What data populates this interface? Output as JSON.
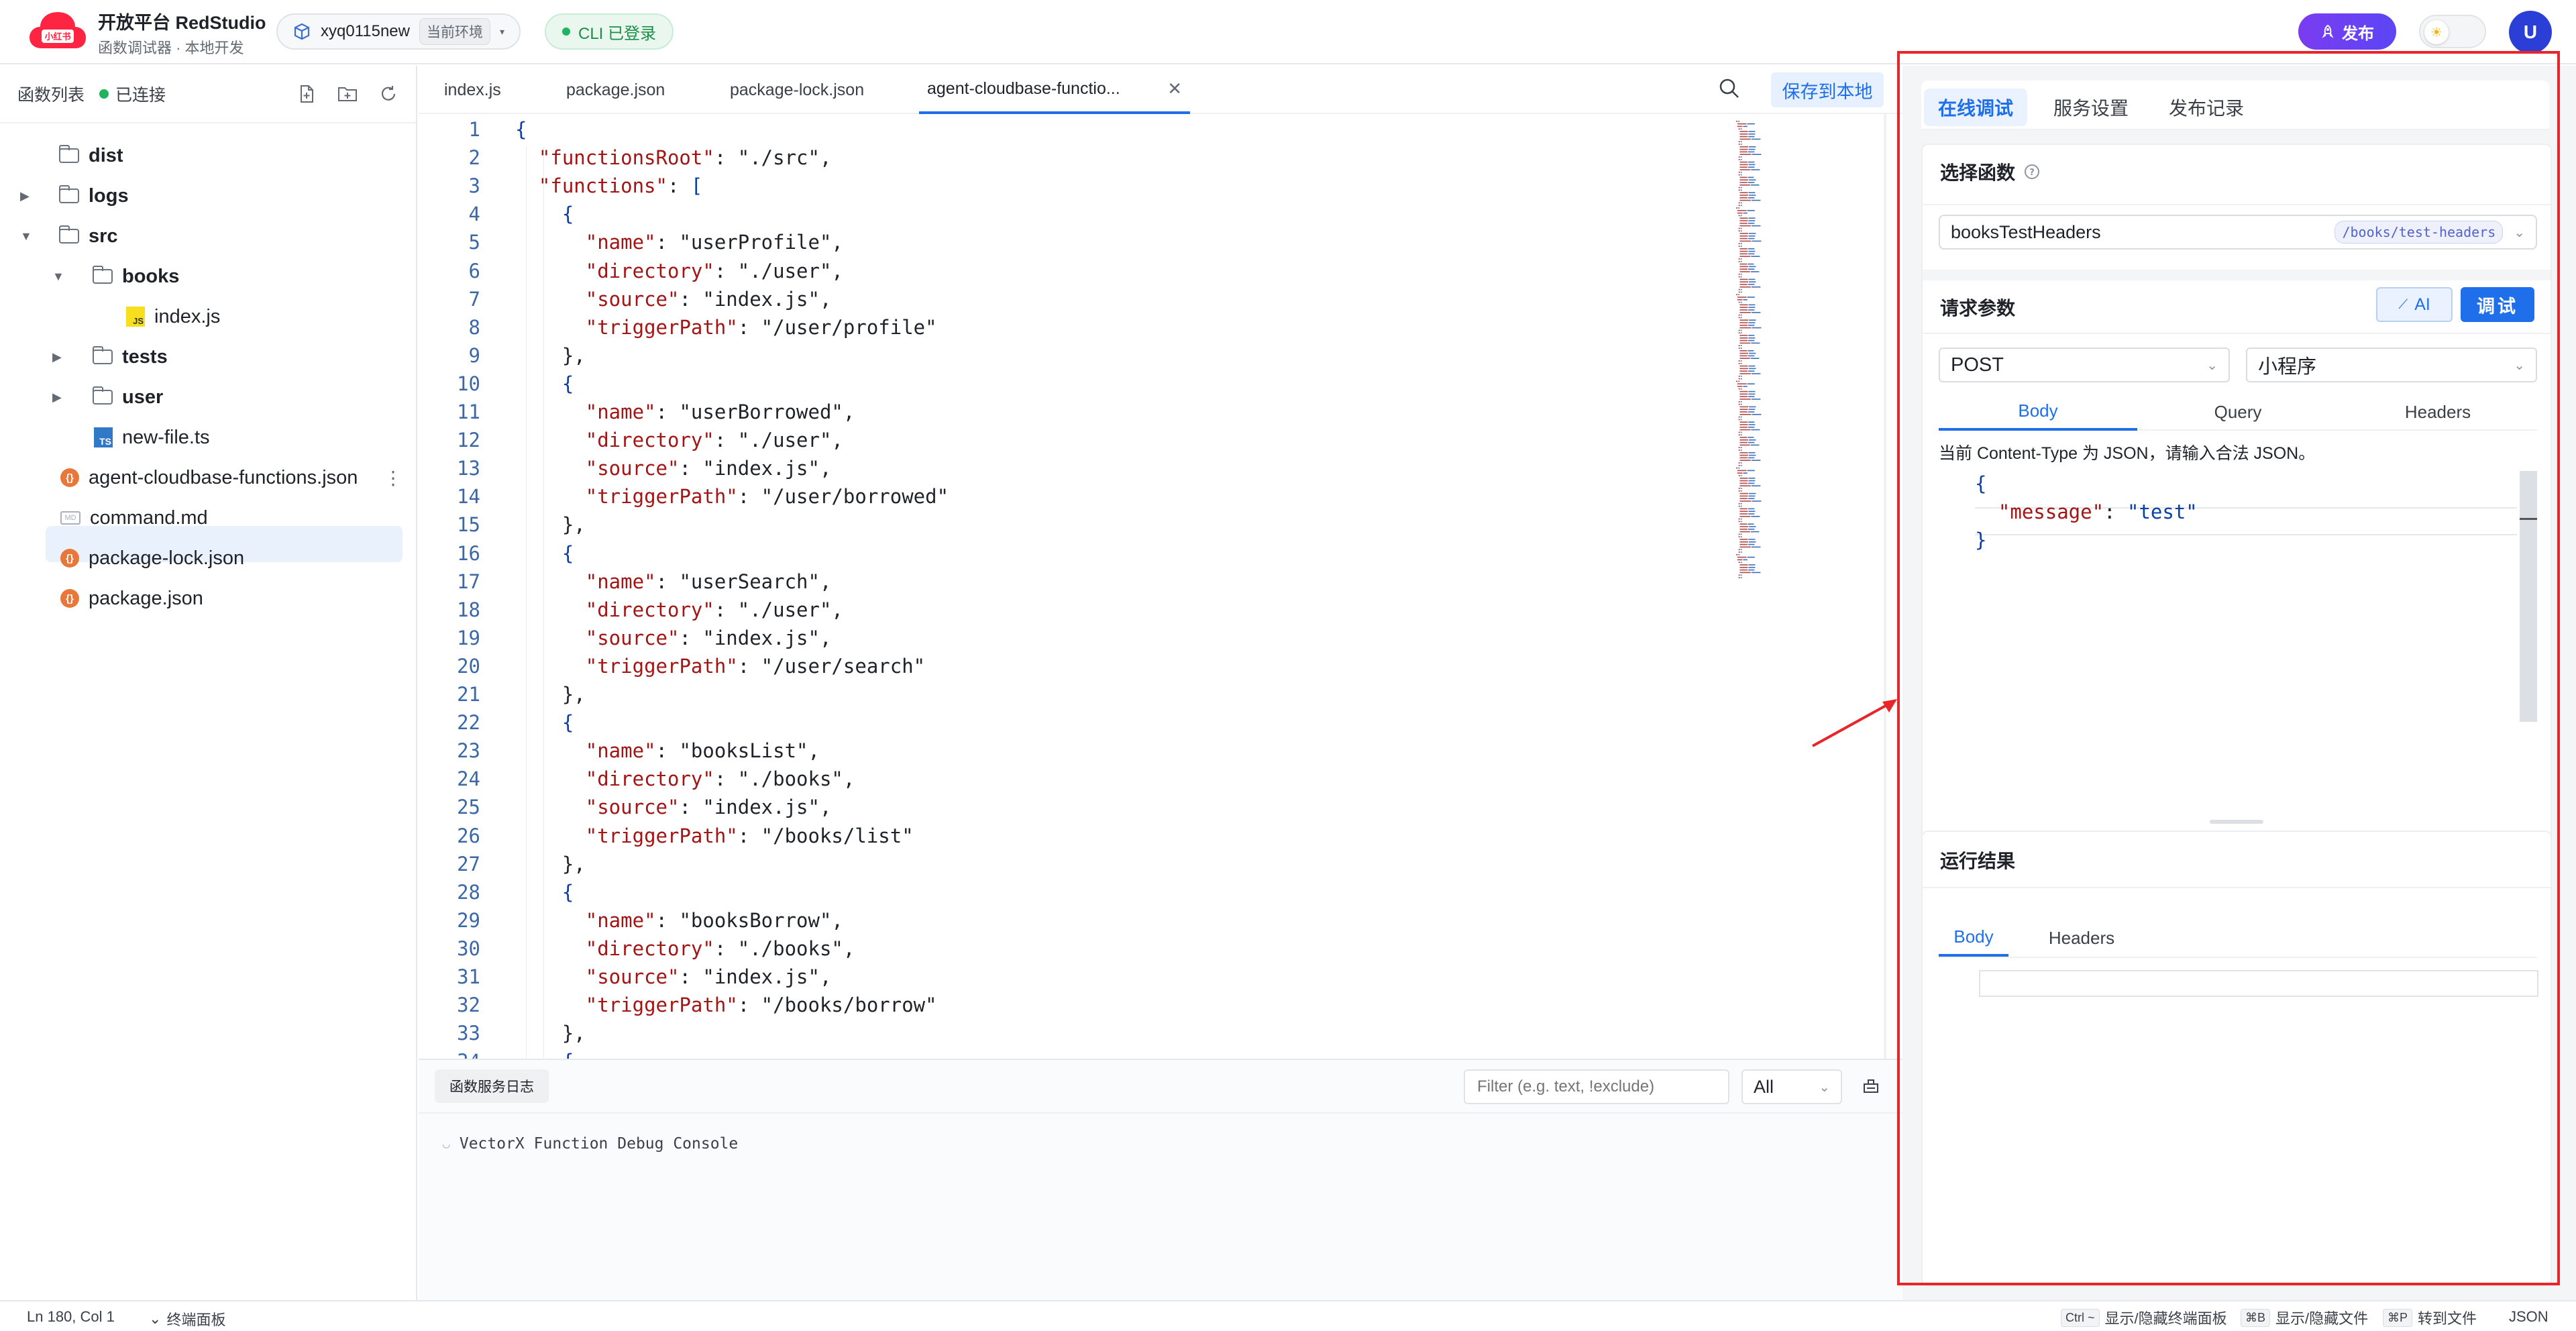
{
  "topbar": {
    "logo_text": "小红书",
    "title": "开放平台 RedStudio",
    "subtitle": "函数调试器 · 本地开发",
    "env_name": "xyq0115new",
    "env_tag": "当前环境",
    "cli_status": "CLI 已登录",
    "publish_label": "发布",
    "avatar_letter": "U"
  },
  "sidebar": {
    "title": "函数列表",
    "status": "已连接",
    "tree": [
      {
        "label": "dist",
        "kind": "folder",
        "expanded": null
      },
      {
        "label": "logs",
        "kind": "folder",
        "expanded": false
      },
      {
        "label": "src",
        "kind": "folder",
        "expanded": true
      },
      {
        "label": "books",
        "kind": "folder",
        "expanded": true
      },
      {
        "label": "index.js",
        "kind": "js"
      },
      {
        "label": "tests",
        "kind": "folder",
        "expanded": false
      },
      {
        "label": "user",
        "kind": "folder",
        "expanded": false
      },
      {
        "label": "new-file.ts",
        "kind": "ts"
      },
      {
        "label": "agent-cloudbase-functions.json",
        "kind": "json",
        "selected": true
      },
      {
        "label": "command.md",
        "kind": "md"
      },
      {
        "label": "package-lock.json",
        "kind": "json"
      },
      {
        "label": "package.json",
        "kind": "json"
      }
    ]
  },
  "editor": {
    "tabs": [
      "index.js",
      "package.json",
      "package-lock.json",
      "agent-cloudbase-functio..."
    ],
    "active_tab": 3,
    "save_label": "保存到本地",
    "lines": [
      "{",
      "  \"functionsRoot\": \"./src\",",
      "  \"functions\": [",
      "    {",
      "      \"name\": \"userProfile\",",
      "      \"directory\": \"./user\",",
      "      \"source\": \"index.js\",",
      "      \"triggerPath\": \"/user/profile\"",
      "    },",
      "    {",
      "      \"name\": \"userBorrowed\",",
      "      \"directory\": \"./user\",",
      "      \"source\": \"index.js\",",
      "      \"triggerPath\": \"/user/borrowed\"",
      "    },",
      "    {",
      "      \"name\": \"userSearch\",",
      "      \"directory\": \"./user\",",
      "      \"source\": \"index.js\",",
      "      \"triggerPath\": \"/user/search\"",
      "    },",
      "    {",
      "      \"name\": \"booksList\",",
      "      \"directory\": \"./books\",",
      "      \"source\": \"index.js\",",
      "      \"triggerPath\": \"/books/list\"",
      "    },",
      "    {",
      "      \"name\": \"booksBorrow\",",
      "      \"directory\": \"./books\",",
      "      \"source\": \"index.js\",",
      "      \"triggerPath\": \"/books/borrow\"",
      "    },",
      "    {"
    ]
  },
  "console": {
    "tab_label": "函数服务日志",
    "filter_placeholder": "Filter (e.g. text, !exclude)",
    "level": "All",
    "line": "VectorX Function Debug Console"
  },
  "right_panel": {
    "tabs": [
      "在线调试",
      "服务设置",
      "发布记录"
    ],
    "active_tab": 0,
    "select_function_title": "选择函数",
    "function_name": "booksTestHeaders",
    "function_path": "/books/test-headers",
    "request_params_title": "请求参数",
    "ai_label": "AI",
    "debug_label": "调试",
    "method": "POST",
    "client": "小程序",
    "request_tabs": [
      "Body",
      "Query",
      "Headers"
    ],
    "content_type_hint": "当前 Content-Type 为 JSON，请输入合法 JSON。",
    "body_lines": [
      "{",
      "  \"message\": \"test\"",
      "}"
    ],
    "result_title": "运行结果",
    "result_tabs": [
      "Body",
      "Headers"
    ]
  },
  "statusbar": {
    "cursor": "Ln 180, Col 1",
    "terminal_panel": "终端面板",
    "shortcut1_key": "Ctrl ~",
    "shortcut1_label": "显示/隐藏终端面板",
    "shortcut2_key": "⌘B",
    "shortcut2_label": "显示/隐藏文件",
    "shortcut3_key": "⌘P",
    "shortcut3_label": "转到文件",
    "language": "JSON"
  },
  "colors": {
    "accent": "#1f6feb",
    "annotation": "#e8262a",
    "brand": "#ff2442",
    "connected": "#22b35e"
  }
}
